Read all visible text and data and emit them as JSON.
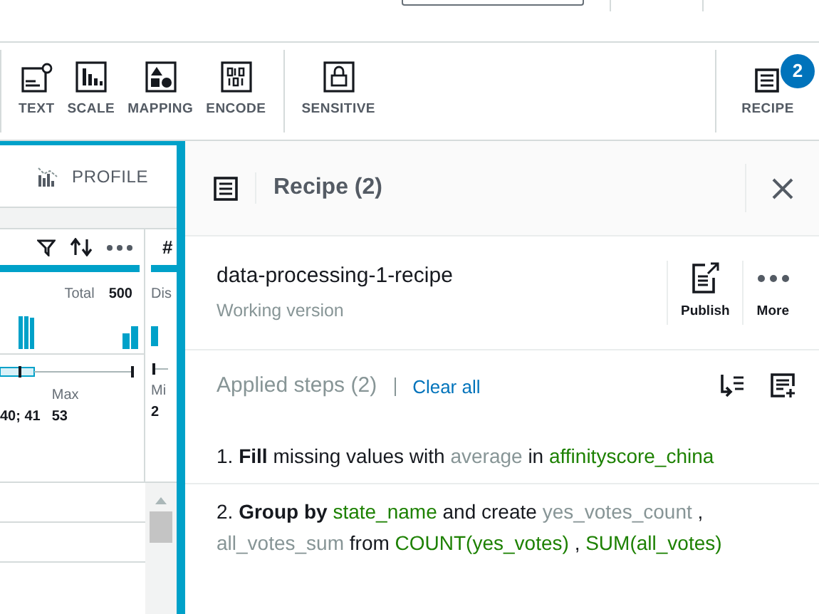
{
  "toolbar": {
    "groups": [
      [
        {
          "label": "TEXT",
          "kind": "text"
        },
        {
          "label": "SCALE",
          "kind": "scale"
        },
        {
          "label": "MAPPING",
          "kind": "mapping"
        },
        {
          "label": "ENCODE",
          "kind": "encode"
        }
      ],
      [
        {
          "label": "SENSITIVE",
          "kind": "sensitive"
        }
      ]
    ],
    "recipe_button": {
      "label": "RECIPE",
      "badge": "2"
    }
  },
  "left_panel": {
    "tab": "PROFILE",
    "column": {
      "total_label": "Total",
      "total": "500",
      "max_label": "Max",
      "values": "40; 41",
      "max": "53"
    },
    "next_column": {
      "type_glyph": "#",
      "label": "Dis",
      "min_label": "Mi",
      "min": "2"
    }
  },
  "recipe_panel": {
    "title": "Recipe (2)",
    "name": "data-processing-1-recipe",
    "version": "Working version",
    "actions": [
      {
        "label": "Publish",
        "kind": "publish"
      },
      {
        "label": "More",
        "kind": "more"
      }
    ],
    "applied_steps": "Applied steps (2)",
    "clear_all": "Clear all",
    "steps": [
      {
        "segments": [
          {
            "kind": "plain",
            "text": "1."
          },
          {
            "kind": "action",
            "text": "Fill"
          },
          {
            "kind": "plain",
            "text": "missing values with"
          },
          {
            "kind": "param",
            "text": "average"
          },
          {
            "kind": "plain",
            "text": "in"
          },
          {
            "kind": "column",
            "text": "affinityscore_china"
          }
        ]
      },
      {
        "segments": [
          {
            "kind": "plain",
            "text": "2."
          },
          {
            "kind": "action",
            "text": "Group by"
          },
          {
            "kind": "column",
            "text": "state_name"
          },
          {
            "kind": "plain",
            "text": "and create"
          },
          {
            "kind": "param",
            "text": "yes_votes_count"
          },
          {
            "kind": "plain",
            "text": ","
          },
          {
            "kind": "param",
            "text": "all_votes_sum"
          },
          {
            "kind": "plain",
            "text": "from"
          },
          {
            "kind": "column",
            "text": "COUNT(yes_votes)"
          },
          {
            "kind": "plain",
            "text": ","
          },
          {
            "kind": "column",
            "text": "SUM(all_votes)"
          }
        ]
      }
    ]
  }
}
